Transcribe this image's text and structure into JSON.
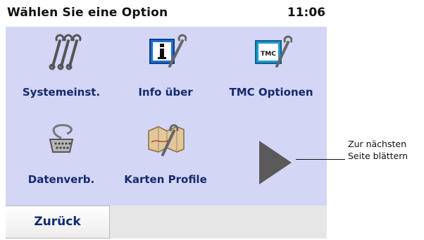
{
  "header": {
    "title": "Wählen Sie eine Option",
    "time": "11:06"
  },
  "menu": {
    "items": [
      {
        "label": "Systemeinst.",
        "icon": "wrenches-icon"
      },
      {
        "label": "Info über",
        "icon": "info-icon"
      },
      {
        "label": "TMC Optionen",
        "icon": "tmc-icon"
      },
      {
        "label": "Datenverb.",
        "icon": "serial-cable-icon"
      },
      {
        "label": "Karten Profile",
        "icon": "map-profile-icon"
      }
    ],
    "next_icon": "play-arrow-icon"
  },
  "footer": {
    "back_label": "Zurück"
  },
  "annotation": {
    "line1": "Zur nächsten",
    "line2": "Seite blättern"
  },
  "colors": {
    "panel": "#d4d6f6",
    "label": "#142a6e",
    "arrow": "#5a5a5a"
  }
}
